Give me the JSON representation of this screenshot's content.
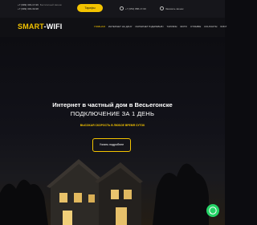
{
  "topbar": {
    "phone1": "+7 (999) 333-17-99",
    "phone1_note": "Бесплатный звонок",
    "phone2": "+7 (999) 333-33-98",
    "tariffs_button": "Тарифы",
    "phone3": "+7 (953) 888-17-99",
    "request_label": "Заказать звонок"
  },
  "logo": {
    "part1": "SMART",
    "part2": "-WIFI"
  },
  "nav": {
    "items": [
      "ГЛАВНАЯ",
      "ИНТЕРНЕТ НА ДАЧУ",
      "ИНТЕРНЕТ В ДЕРЕВНЮ",
      "ТАРИФЫ",
      "ФОТО",
      "ОТЗЫВЫ",
      "КОНТАКТЫ",
      "БЛОГ"
    ]
  },
  "hero": {
    "title": "Интернет в частный дом в Весьегонске",
    "subtitle": "ПОДКЛЮЧЕНИЕ ЗА 1 ДЕНЬ",
    "tagline": "ВЫСОКАЯ СКОРОСТЬ В ЛЮБОЕ ВРЕМЯ СУТОК",
    "button": "Узнать подробнее"
  },
  "colors": {
    "accent": "#f3c300",
    "whatsapp": "#25d366"
  },
  "icons": {
    "whatsapp": "whatsapp-icon",
    "phone": "phone-icon",
    "mail": "mail-icon"
  }
}
